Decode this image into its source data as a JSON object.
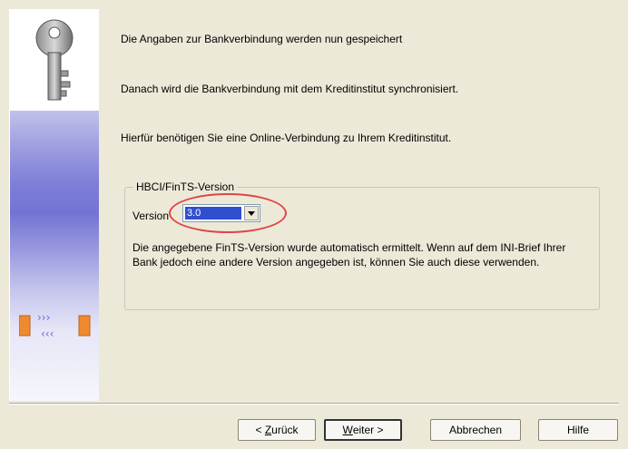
{
  "intro": {
    "line1": "Die Angaben zur Bankverbindung werden nun gespeichert",
    "line2": "Danach wird die Bankverbindung mit dem Kreditinstitut synchronisiert.",
    "line3": "Hierfür benötigen Sie eine Online-Verbindung zu Ihrem Kreditinstitut."
  },
  "group": {
    "title": "HBCI/FinTS-Version",
    "version_label": "Version",
    "version_value": "3.0",
    "description": "Die angegebene FinTS-Version wurde automatisch ermittelt. Wenn auf dem INI-Brief Ihrer Bank jedoch eine andere Version angegeben ist, können Sie auch diese verwenden."
  },
  "buttons": {
    "back_prefix": "< ",
    "back_mnemonic": "Z",
    "back_rest": "urück",
    "next_mnemonic": "W",
    "next_rest": "eiter >",
    "cancel": "Abbrechen",
    "help": "Hilfe"
  },
  "colors": {
    "highlight_ellipse": "#e04545",
    "selection": "#2f4fcf",
    "dialog_bg": "#ece9d8"
  },
  "icons": [
    "key-icon",
    "transfer-arrows-icon",
    "dropdown-arrow-icon"
  ]
}
